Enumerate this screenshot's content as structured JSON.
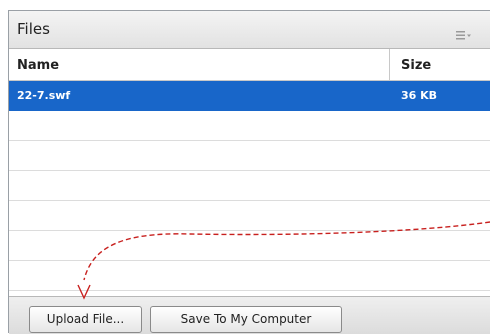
{
  "panel": {
    "title": "Files",
    "menu_icon": "list-menu-icon"
  },
  "table": {
    "columns": [
      "Name",
      "Size"
    ],
    "rows": [
      {
        "name": "22-7.swf",
        "size": "36 KB",
        "selected": true
      }
    ]
  },
  "footer": {
    "upload_label": "Upload File...",
    "save_label": "Save To My Computer"
  },
  "colors": {
    "selection": "#1866c9",
    "arrow": "#c8201e"
  }
}
